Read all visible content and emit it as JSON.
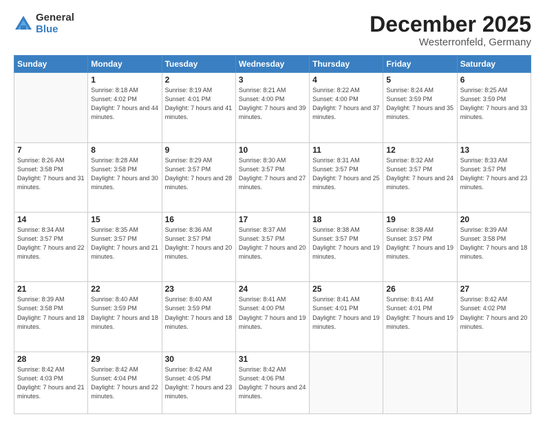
{
  "logo": {
    "general": "General",
    "blue": "Blue"
  },
  "title": {
    "month": "December 2025",
    "location": "Westerronfeld, Germany"
  },
  "weekdays": [
    "Sunday",
    "Monday",
    "Tuesday",
    "Wednesday",
    "Thursday",
    "Friday",
    "Saturday"
  ],
  "weeks": [
    [
      {
        "num": "",
        "sunrise": "",
        "sunset": "",
        "daylight": ""
      },
      {
        "num": "1",
        "sunrise": "Sunrise: 8:18 AM",
        "sunset": "Sunset: 4:02 PM",
        "daylight": "Daylight: 7 hours and 44 minutes."
      },
      {
        "num": "2",
        "sunrise": "Sunrise: 8:19 AM",
        "sunset": "Sunset: 4:01 PM",
        "daylight": "Daylight: 7 hours and 41 minutes."
      },
      {
        "num": "3",
        "sunrise": "Sunrise: 8:21 AM",
        "sunset": "Sunset: 4:00 PM",
        "daylight": "Daylight: 7 hours and 39 minutes."
      },
      {
        "num": "4",
        "sunrise": "Sunrise: 8:22 AM",
        "sunset": "Sunset: 4:00 PM",
        "daylight": "Daylight: 7 hours and 37 minutes."
      },
      {
        "num": "5",
        "sunrise": "Sunrise: 8:24 AM",
        "sunset": "Sunset: 3:59 PM",
        "daylight": "Daylight: 7 hours and 35 minutes."
      },
      {
        "num": "6",
        "sunrise": "Sunrise: 8:25 AM",
        "sunset": "Sunset: 3:59 PM",
        "daylight": "Daylight: 7 hours and 33 minutes."
      }
    ],
    [
      {
        "num": "7",
        "sunrise": "Sunrise: 8:26 AM",
        "sunset": "Sunset: 3:58 PM",
        "daylight": "Daylight: 7 hours and 31 minutes."
      },
      {
        "num": "8",
        "sunrise": "Sunrise: 8:28 AM",
        "sunset": "Sunset: 3:58 PM",
        "daylight": "Daylight: 7 hours and 30 minutes."
      },
      {
        "num": "9",
        "sunrise": "Sunrise: 8:29 AM",
        "sunset": "Sunset: 3:57 PM",
        "daylight": "Daylight: 7 hours and 28 minutes."
      },
      {
        "num": "10",
        "sunrise": "Sunrise: 8:30 AM",
        "sunset": "Sunset: 3:57 PM",
        "daylight": "Daylight: 7 hours and 27 minutes."
      },
      {
        "num": "11",
        "sunrise": "Sunrise: 8:31 AM",
        "sunset": "Sunset: 3:57 PM",
        "daylight": "Daylight: 7 hours and 25 minutes."
      },
      {
        "num": "12",
        "sunrise": "Sunrise: 8:32 AM",
        "sunset": "Sunset: 3:57 PM",
        "daylight": "Daylight: 7 hours and 24 minutes."
      },
      {
        "num": "13",
        "sunrise": "Sunrise: 8:33 AM",
        "sunset": "Sunset: 3:57 PM",
        "daylight": "Daylight: 7 hours and 23 minutes."
      }
    ],
    [
      {
        "num": "14",
        "sunrise": "Sunrise: 8:34 AM",
        "sunset": "Sunset: 3:57 PM",
        "daylight": "Daylight: 7 hours and 22 minutes."
      },
      {
        "num": "15",
        "sunrise": "Sunrise: 8:35 AM",
        "sunset": "Sunset: 3:57 PM",
        "daylight": "Daylight: 7 hours and 21 minutes."
      },
      {
        "num": "16",
        "sunrise": "Sunrise: 8:36 AM",
        "sunset": "Sunset: 3:57 PM",
        "daylight": "Daylight: 7 hours and 20 minutes."
      },
      {
        "num": "17",
        "sunrise": "Sunrise: 8:37 AM",
        "sunset": "Sunset: 3:57 PM",
        "daylight": "Daylight: 7 hours and 20 minutes."
      },
      {
        "num": "18",
        "sunrise": "Sunrise: 8:38 AM",
        "sunset": "Sunset: 3:57 PM",
        "daylight": "Daylight: 7 hours and 19 minutes."
      },
      {
        "num": "19",
        "sunrise": "Sunrise: 8:38 AM",
        "sunset": "Sunset: 3:57 PM",
        "daylight": "Daylight: 7 hours and 19 minutes."
      },
      {
        "num": "20",
        "sunrise": "Sunrise: 8:39 AM",
        "sunset": "Sunset: 3:58 PM",
        "daylight": "Daylight: 7 hours and 18 minutes."
      }
    ],
    [
      {
        "num": "21",
        "sunrise": "Sunrise: 8:39 AM",
        "sunset": "Sunset: 3:58 PM",
        "daylight": "Daylight: 7 hours and 18 minutes."
      },
      {
        "num": "22",
        "sunrise": "Sunrise: 8:40 AM",
        "sunset": "Sunset: 3:59 PM",
        "daylight": "Daylight: 7 hours and 18 minutes."
      },
      {
        "num": "23",
        "sunrise": "Sunrise: 8:40 AM",
        "sunset": "Sunset: 3:59 PM",
        "daylight": "Daylight: 7 hours and 18 minutes."
      },
      {
        "num": "24",
        "sunrise": "Sunrise: 8:41 AM",
        "sunset": "Sunset: 4:00 PM",
        "daylight": "Daylight: 7 hours and 19 minutes."
      },
      {
        "num": "25",
        "sunrise": "Sunrise: 8:41 AM",
        "sunset": "Sunset: 4:01 PM",
        "daylight": "Daylight: 7 hours and 19 minutes."
      },
      {
        "num": "26",
        "sunrise": "Sunrise: 8:41 AM",
        "sunset": "Sunset: 4:01 PM",
        "daylight": "Daylight: 7 hours and 19 minutes."
      },
      {
        "num": "27",
        "sunrise": "Sunrise: 8:42 AM",
        "sunset": "Sunset: 4:02 PM",
        "daylight": "Daylight: 7 hours and 20 minutes."
      }
    ],
    [
      {
        "num": "28",
        "sunrise": "Sunrise: 8:42 AM",
        "sunset": "Sunset: 4:03 PM",
        "daylight": "Daylight: 7 hours and 21 minutes."
      },
      {
        "num": "29",
        "sunrise": "Sunrise: 8:42 AM",
        "sunset": "Sunset: 4:04 PM",
        "daylight": "Daylight: 7 hours and 22 minutes."
      },
      {
        "num": "30",
        "sunrise": "Sunrise: 8:42 AM",
        "sunset": "Sunset: 4:05 PM",
        "daylight": "Daylight: 7 hours and 23 minutes."
      },
      {
        "num": "31",
        "sunrise": "Sunrise: 8:42 AM",
        "sunset": "Sunset: 4:06 PM",
        "daylight": "Daylight: 7 hours and 24 minutes."
      },
      {
        "num": "",
        "sunrise": "",
        "sunset": "",
        "daylight": ""
      },
      {
        "num": "",
        "sunrise": "",
        "sunset": "",
        "daylight": ""
      },
      {
        "num": "",
        "sunrise": "",
        "sunset": "",
        "daylight": ""
      }
    ]
  ]
}
